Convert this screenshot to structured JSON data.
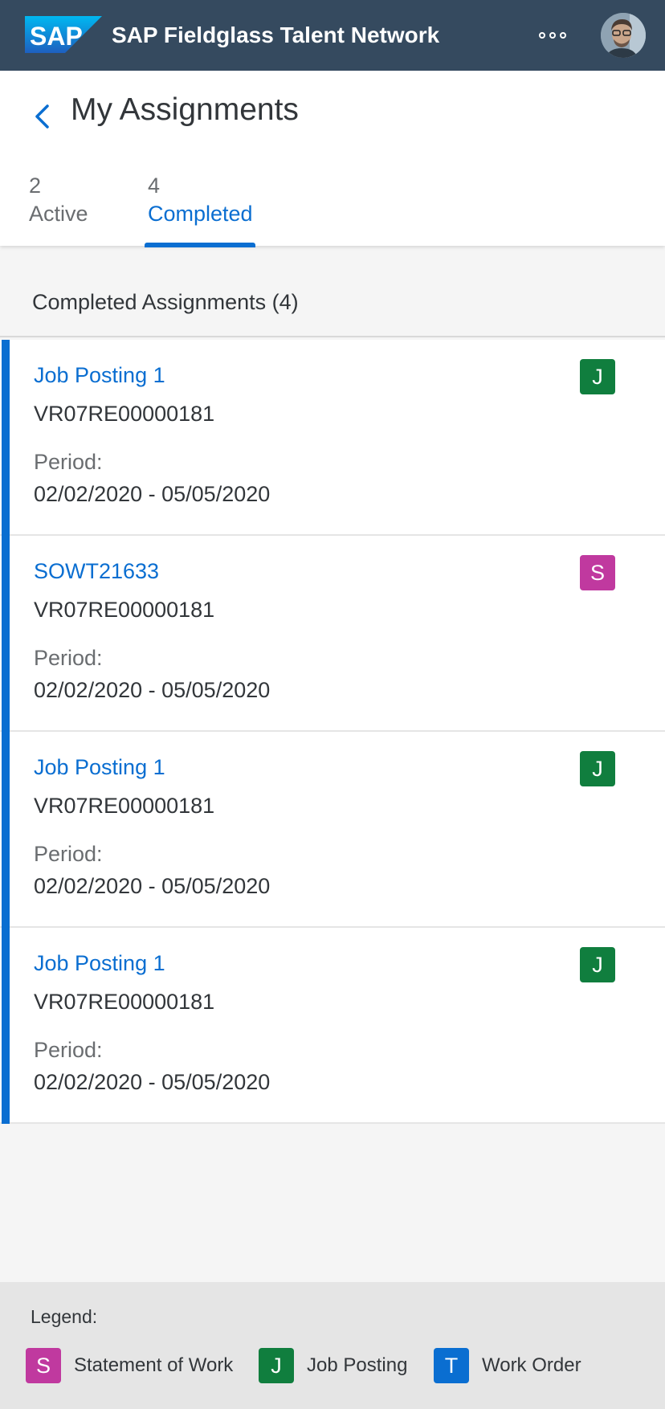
{
  "shell": {
    "logo_text": "SAP",
    "title": "SAP Fieldglass Talent Network",
    "overflow_icon": "overflow-dots-icon",
    "avatar_icon": "user-avatar"
  },
  "colors": {
    "shell_bg": "#354a5f",
    "accent": "#0a6ed1",
    "badge_statement_of_work": "#c0399f",
    "badge_job_posting": "#107e3e",
    "badge_work_order": "#0a6ed1"
  },
  "header": {
    "back_icon": "chevron-left-icon",
    "title": "My Assignments"
  },
  "tabs": [
    {
      "count": "2",
      "label": "Active",
      "selected": false
    },
    {
      "count": "4",
      "label": "Completed",
      "selected": true
    }
  ],
  "list": {
    "header": "Completed Assignments (4)",
    "items": [
      {
        "title": "Job Posting 1",
        "id": "VR07RE00000181",
        "period_label": "Period:",
        "period": "02/02/2020 - 05/05/2020",
        "badge": "J",
        "type": "job_posting"
      },
      {
        "title": "SOWT21633",
        "id": "VR07RE00000181",
        "period_label": "Period:",
        "period": "02/02/2020 - 05/05/2020",
        "badge": "S",
        "type": "statement_of_work"
      },
      {
        "title": "Job Posting 1",
        "id": "VR07RE00000181",
        "period_label": "Period:",
        "period": "02/02/2020 - 05/05/2020",
        "badge": "J",
        "type": "job_posting"
      },
      {
        "title": "Job Posting 1",
        "id": "VR07RE00000181",
        "period_label": "Period:",
        "period": "02/02/2020 - 05/05/2020",
        "badge": "J",
        "type": "job_posting"
      }
    ]
  },
  "legend": {
    "title": "Legend:",
    "items": [
      {
        "badge": "S",
        "label": "Statement of Work"
      },
      {
        "badge": "J",
        "label": "Job Posting"
      },
      {
        "badge": "T",
        "label": "Work Order"
      }
    ]
  }
}
